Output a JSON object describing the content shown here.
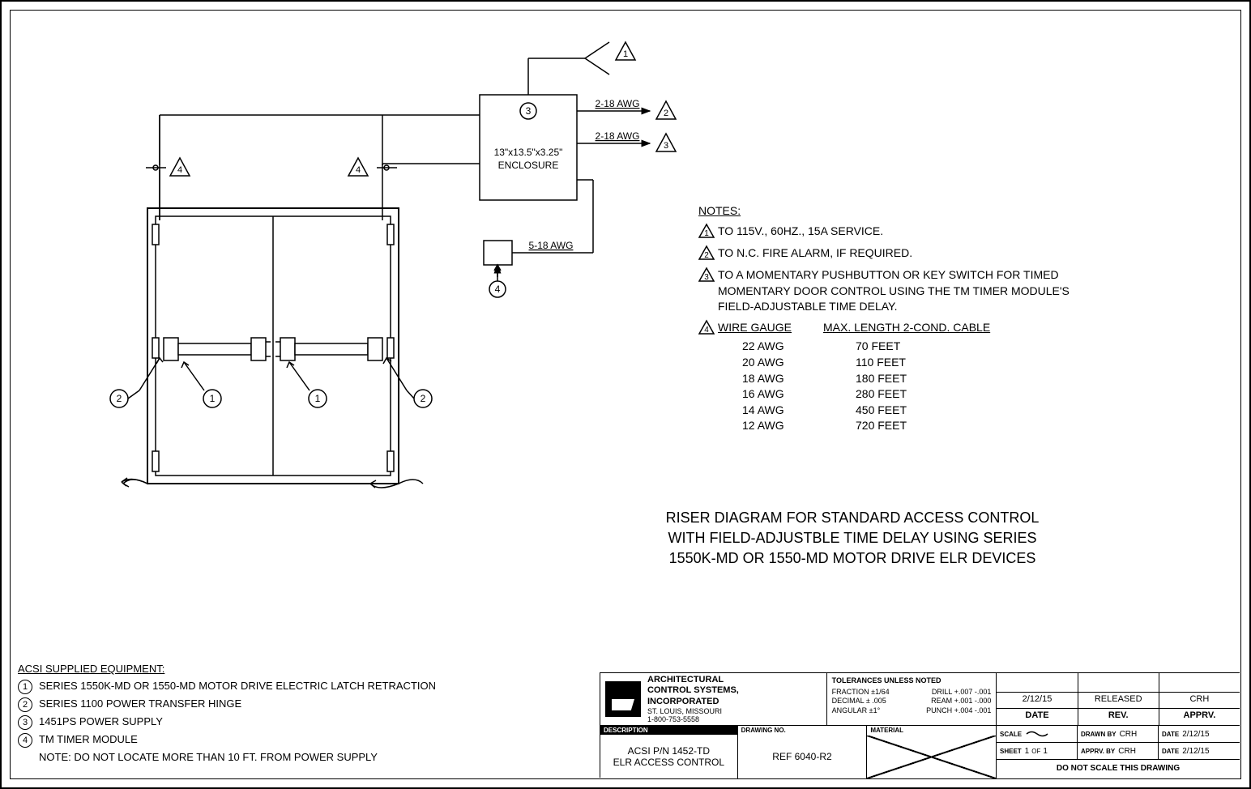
{
  "diagram": {
    "enclosure_label": "13\"x13.5\"x3.25\"\nENCLOSURE",
    "enclosure_marker": "3",
    "wire1": "2-18 AWG",
    "wire1_marker": "2",
    "wire2": "2-18 AWG",
    "wire2_marker": "3",
    "wire3": "5-18 AWG",
    "top_pigtail_marker": "1",
    "left_door_tri_left": "4",
    "left_door_tri_right": "4",
    "bottom_module_marker": "4",
    "door_markers": {
      "left_outer": "2",
      "left_inner": "1",
      "right_inner": "1",
      "right_outer": "2"
    }
  },
  "notes": {
    "title": "NOTES:",
    "items": [
      {
        "num": "1",
        "text": "TO 115V., 60HZ., 15A SERVICE."
      },
      {
        "num": "2",
        "text": "TO N.C. FIRE ALARM, IF REQUIRED."
      },
      {
        "num": "3",
        "text": "TO A MOMENTARY PUSHBUTTON OR KEY SWITCH FOR TIMED MOMENTARY DOOR CONTROL USING THE TM TIMER MODULE'S FIELD-ADJUSTABLE TIME DELAY."
      }
    ],
    "wire_gauge_marker": "4",
    "wire_gauge_headers": [
      "WIRE GAUGE",
      "MAX. LENGTH 2-COND. CABLE"
    ],
    "wire_gauge_rows": [
      {
        "gauge": "22 AWG",
        "length": "70 FEET"
      },
      {
        "gauge": "20 AWG",
        "length": "110 FEET"
      },
      {
        "gauge": "18 AWG",
        "length": "180 FEET"
      },
      {
        "gauge": "16 AWG",
        "length": "280 FEET"
      },
      {
        "gauge": "14 AWG",
        "length": "450 FEET"
      },
      {
        "gauge": "12 AWG",
        "length": "720 FEET"
      }
    ]
  },
  "riser_title": "RISER DIAGRAM FOR STANDARD ACCESS CONTROL\nWITH FIELD-ADJUSTBLE TIME DELAY USING SERIES\n1550K-MD OR 1550-MD MOTOR DRIVE ELR DEVICES",
  "acsi": {
    "title": "ACSI SUPPLIED EQUIPMENT:",
    "items": [
      {
        "num": "1",
        "text": "SERIES 1550K-MD OR 1550-MD MOTOR DRIVE ELECTRIC LATCH RETRACTION"
      },
      {
        "num": "2",
        "text": "SERIES 1100 POWER TRANSFER HINGE"
      },
      {
        "num": "3",
        "text": "1451PS POWER SUPPLY"
      },
      {
        "num": "4",
        "text": "TM TIMER MODULE"
      }
    ],
    "note": "NOTE: DO NOT LOCATE MORE THAN 10 FT. FROM POWER SUPPLY"
  },
  "title_block": {
    "company": {
      "name": "ARCHITECTURAL\nCONTROL SYSTEMS,\nINCORPORATED",
      "loc": "ST. LOUIS, MISSOURI",
      "phone": "1-800-753-5558"
    },
    "tolerances": {
      "title": "TOLERANCES UNLESS NOTED",
      "fraction": "FRACTION ±1/64",
      "decimal": "DECIMAL ± .005",
      "angular": "ANGULAR ±1°",
      "drill": "DRILL +.007 -.001",
      "ream": "REAM +.001 -.000",
      "punch": "PUNCH +.004 -.001"
    },
    "rev_row": {
      "date": "2/12/15",
      "rev": "RELEASED",
      "apprv": "CRH"
    },
    "rev_headers": {
      "date": "DATE",
      "rev": "REV.",
      "apprv": "APPRV."
    },
    "description_label": "DESCRIPTION",
    "description": "ACSI P/N 1452-TD\nELR ACCESS CONTROL",
    "drawing_no_label": "DRAWING NO.",
    "drawing_no": "REF 6040-R2",
    "material_label": "MATERIAL",
    "scale_label": "SCALE",
    "drawn_by_label": "DRAWN BY",
    "drawn_by": "CRH",
    "date1_label": "DATE",
    "date1": "2/12/15",
    "sheet_label": "SHEET",
    "sheet_num": "1",
    "sheet_of": "OF",
    "sheet_total": "1",
    "apprv_by_label": "APPRV. BY",
    "apprv_by": "CRH",
    "date2_label": "DATE",
    "date2": "2/12/15",
    "no_scale": "DO NOT SCALE THIS DRAWING"
  }
}
